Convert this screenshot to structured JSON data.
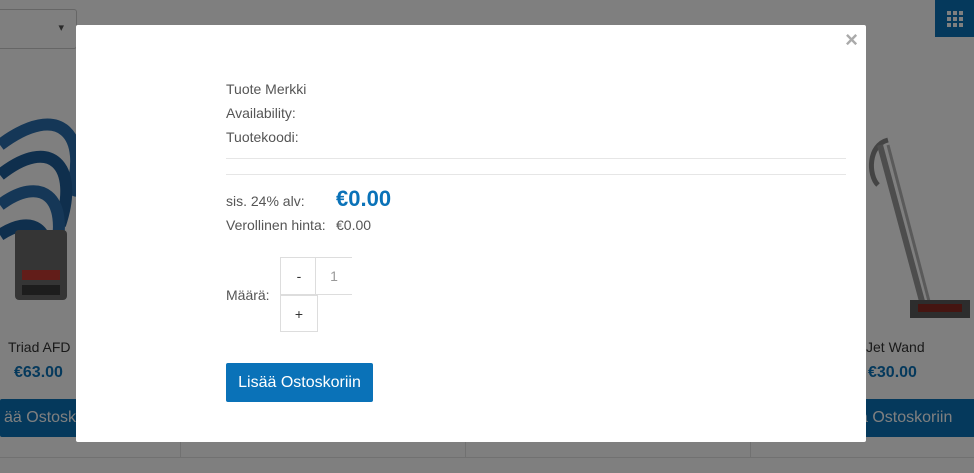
{
  "background": {
    "sort_caret": "▾",
    "products": [
      {
        "name": "Triad AFD",
        "price": "€63.00",
        "button": "Lisää Ostoskoriin"
      },
      {
        "name": "Mini Jet Wand",
        "name_visible": "i Jet Wand",
        "price": "€30.00",
        "button": "Lisää Ostoskoriin",
        "button_visible": "ä Ostoskoriin"
      }
    ],
    "first_button_visible": "ää Ostoskor",
    "brand_color": "#0a72b8"
  },
  "modal": {
    "close_label": "×",
    "brand_label": "Tuote Merkki",
    "availability_label": "Availability:",
    "sku_label": "Tuotekoodi:",
    "vat_label": "sis. 24% alv:",
    "price": "€0.00",
    "tax_price_label": "Verollinen hinta:",
    "tax_price": "€0.00",
    "quantity_label": "Määrä:",
    "decrement": "-",
    "quantity": "1",
    "increment": "+",
    "add_to_cart": "Lisää Ostoskoriin"
  }
}
